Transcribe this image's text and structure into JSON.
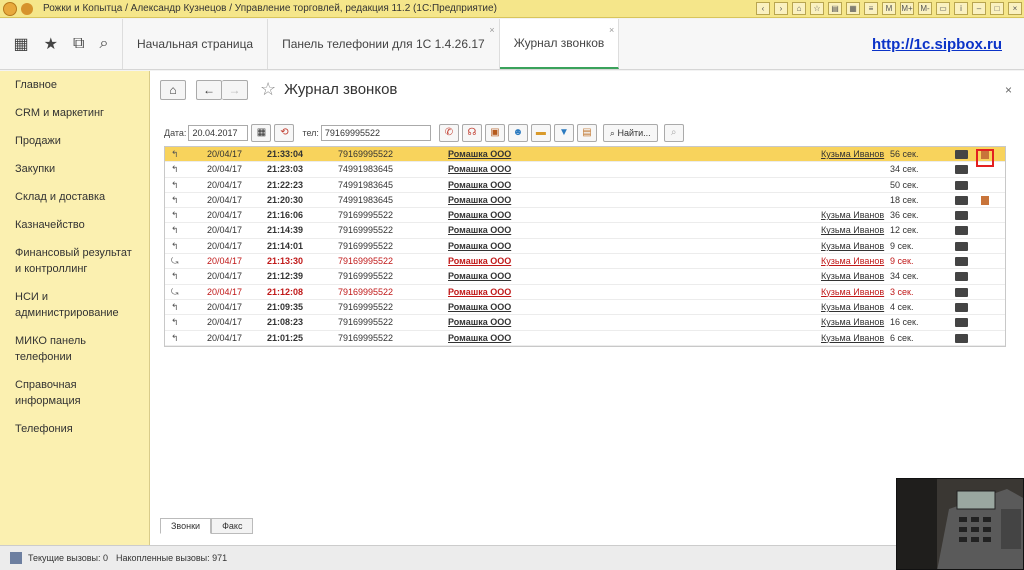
{
  "window": {
    "title": "Рожки и Копытца / Александр Кузнецов / Управление торговлей, редакция 11.2  (1С:Предприятие)"
  },
  "titlebar_icons": [
    "M",
    "M+",
    "M-"
  ],
  "nav": {
    "tabs": [
      {
        "label": "Начальная страница"
      },
      {
        "label": "Панель телефонии для 1С 1.4.26.17"
      },
      {
        "label": "Журнал звонков"
      }
    ],
    "site_link": "http://1c.sipbox.ru"
  },
  "sidebar": {
    "items": [
      {
        "label": "Главное"
      },
      {
        "label": "CRM и маркетинг"
      },
      {
        "label": "Продажи"
      },
      {
        "label": "Закупки"
      },
      {
        "label": "Склад и доставка"
      },
      {
        "label": "Казначейство"
      },
      {
        "label": "Финансовый результат и контроллинг"
      },
      {
        "label": "НСИ и администрирование"
      },
      {
        "label": "МИКО панель телефонии"
      },
      {
        "label": "Справочная информация"
      },
      {
        "label": "Телефония"
      }
    ]
  },
  "page": {
    "title": "Журнал звонков"
  },
  "toolbar": {
    "date_label": "Дата:",
    "date_value": "20.04.2017",
    "phone_label": "тел:",
    "phone_value": "79169995522",
    "find_label": "Найти..."
  },
  "calls": [
    {
      "date": "20/04/17",
      "time": "21:33:04",
      "number": "79169995522",
      "org": "Ромашка ООО",
      "manager": "Кузьма Иванов",
      "duration": "56 сек.",
      "missed": false,
      "selected": true,
      "note": true
    },
    {
      "date": "20/04/17",
      "time": "21:23:03",
      "number": "74991983645",
      "org": "Ромашка ООО",
      "manager": "",
      "duration": "34 сек.",
      "missed": false,
      "selected": false,
      "note": false
    },
    {
      "date": "20/04/17",
      "time": "21:22:23",
      "number": "74991983645",
      "org": "Ромашка ООО",
      "manager": "",
      "duration": "50 сек.",
      "missed": false,
      "selected": false,
      "note": false
    },
    {
      "date": "20/04/17",
      "time": "21:20:30",
      "number": "74991983645",
      "org": "Ромашка ООО",
      "manager": "",
      "duration": "18 сек.",
      "missed": false,
      "selected": false,
      "note": true
    },
    {
      "date": "20/04/17",
      "time": "21:16:06",
      "number": "79169995522",
      "org": "Ромашка ООО",
      "manager": "Кузьма Иванов",
      "duration": "36 сек.",
      "missed": false,
      "selected": false,
      "note": false
    },
    {
      "date": "20/04/17",
      "time": "21:14:39",
      "number": "79169995522",
      "org": "Ромашка ООО",
      "manager": "Кузьма Иванов",
      "duration": "12 сек.",
      "missed": false,
      "selected": false,
      "note": false
    },
    {
      "date": "20/04/17",
      "time": "21:14:01",
      "number": "79169995522",
      "org": "Ромашка ООО",
      "manager": "Кузьма Иванов",
      "duration": "9 сек.",
      "missed": false,
      "selected": false,
      "note": false
    },
    {
      "date": "20/04/17",
      "time": "21:13:30",
      "number": "79169995522",
      "org": "Ромашка ООО",
      "manager": "Кузьма Иванов",
      "duration": "9 сек.",
      "missed": true,
      "selected": false,
      "note": false
    },
    {
      "date": "20/04/17",
      "time": "21:12:39",
      "number": "79169995522",
      "org": "Ромашка ООО",
      "manager": "Кузьма Иванов",
      "duration": "34 сек.",
      "missed": false,
      "selected": false,
      "note": false
    },
    {
      "date": "20/04/17",
      "time": "21:12:08",
      "number": "79169995522",
      "org": "Ромашка ООО",
      "manager": "Кузьма Иванов",
      "duration": "3 сек.",
      "missed": true,
      "selected": false,
      "note": false
    },
    {
      "date": "20/04/17",
      "time": "21:09:35",
      "number": "79169995522",
      "org": "Ромашка ООО",
      "manager": "Кузьма Иванов",
      "duration": "4 сек.",
      "missed": false,
      "selected": false,
      "note": false
    },
    {
      "date": "20/04/17",
      "time": "21:08:23",
      "number": "79169995522",
      "org": "Ромашка ООО",
      "manager": "Кузьма Иванов",
      "duration": "16 сек.",
      "missed": false,
      "selected": false,
      "note": false
    },
    {
      "date": "20/04/17",
      "time": "21:01:25",
      "number": "79169995522",
      "org": "Ромашка ООО",
      "manager": "Кузьма Иванов",
      "duration": "6 сек.",
      "missed": false,
      "selected": false,
      "note": false
    }
  ],
  "bottom_tabs": [
    {
      "label": "Звонки"
    },
    {
      "label": "Факс"
    }
  ],
  "status": {
    "current": "Текущие вызовы: 0",
    "accumulated": "Накопленные вызовы: 971"
  },
  "colors": {
    "sidebar": "#fbf0b0",
    "selected_row": "#f8d35c",
    "missed": "#c01818",
    "tab_accent": "#3aa25b"
  }
}
